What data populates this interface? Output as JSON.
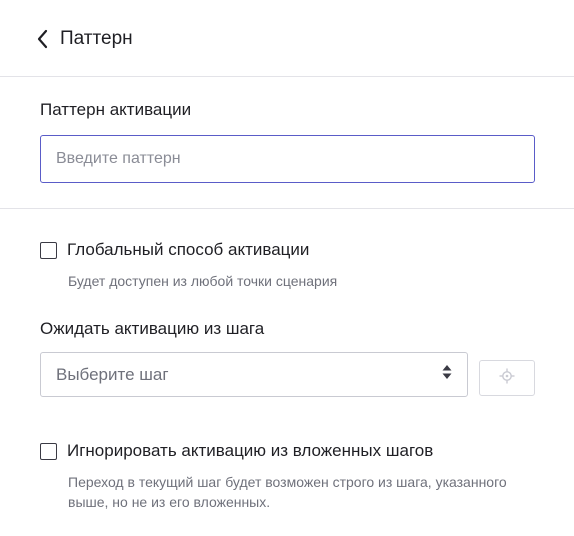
{
  "header": {
    "back_icon": "chevron-left-icon",
    "title": "Паттерн"
  },
  "pattern": {
    "label": "Паттерн активации",
    "placeholder": "Введите паттерн",
    "value": ""
  },
  "global_activation": {
    "label": "Глобальный способ активации",
    "hint": "Будет доступен из любой точки сценария",
    "checked": false
  },
  "wait_activation": {
    "label": "Ожидать активацию из шага",
    "select_placeholder": "Выберите шаг",
    "select_icon": "sort-arrows-icon",
    "locate_icon": "crosshair-icon"
  },
  "ignore_nested": {
    "label": "Игнорировать активацию из вложенных шагов",
    "hint": "Переход в текущий шаг будет возможен строго из шага, указанного выше, но не из его вложенных.",
    "checked": false
  },
  "colors": {
    "accent": "#5a5cc8",
    "text": "#1f1f24",
    "muted": "#6f717b",
    "divider": "#e3e3e8"
  }
}
